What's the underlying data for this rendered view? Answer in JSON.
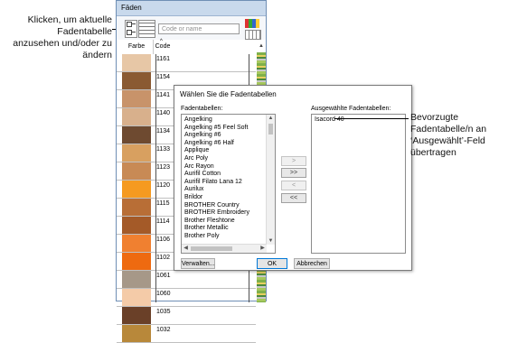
{
  "annotations": {
    "left_lines": [
      "Klicken, um aktuelle",
      "Fadentabelle",
      "anzusehen und/oder zu",
      "ändern"
    ],
    "right_lines": [
      "Bevorzugte",
      "Fadentabelle/n an",
      "‘Ausgewählt’-Feld",
      "übertragen"
    ]
  },
  "thread_window": {
    "title": "Fäden",
    "search_placeholder": "Code or name",
    "col_swatch": "Farbe",
    "col_code": "Code",
    "rows": [
      {
        "code": "1161",
        "color": "#e7c7a6"
      },
      {
        "code": "1154",
        "color": "#8a5a32"
      },
      {
        "code": "1141",
        "color": "#c8936a"
      },
      {
        "code": "1140",
        "color": "#d8b08c"
      },
      {
        "code": "1134",
        "color": "#6e4a30"
      },
      {
        "code": "1133",
        "color": "#d8a060"
      },
      {
        "code": "1123",
        "color": "#c88a55"
      },
      {
        "code": "1120",
        "color": "#f59a20"
      },
      {
        "code": "1115",
        "color": "#b86e36"
      },
      {
        "code": "1114",
        "color": "#a45a28"
      },
      {
        "code": "1106",
        "color": "#f08030"
      },
      {
        "code": "1102",
        "color": "#ee6a10"
      },
      {
        "code": "1061",
        "color": "#a69888"
      },
      {
        "code": "1060",
        "color": "#f4cba8"
      },
      {
        "code": "1035",
        "color": "#6a4028"
      },
      {
        "code": "1032",
        "color": "#b8883a"
      }
    ]
  },
  "dialog": {
    "title": "Wählen Sie die Fadentabellen",
    "available_label": "Fadentabellen:",
    "selected_label": "Ausgewählte Fadentabellen:",
    "available": [
      "Angelking",
      "Angelking #5 Feel Soft",
      "Angelking #6",
      "Angelking #6 Half",
      "Applique",
      "Arc Poly",
      "Arc Rayon",
      "Aurifil Cotton",
      "Aurifil Filato Lana 12",
      "Aurilux",
      "Brildor",
      "BROTHER Country",
      "BROTHER Embroidery",
      "Brother Fleshtone",
      "Brother Metallic",
      "Brother Poly"
    ],
    "selected": [
      "Isacord 40"
    ],
    "move_buttons": [
      ">",
      ">>",
      "<",
      "<<"
    ],
    "manage_label": "Verwalten...",
    "ok_label": "OK",
    "cancel_label": "Abbrechen"
  },
  "colors": {
    "title_bar": "#c8d9ec",
    "default_button_border": "#0078d7"
  }
}
